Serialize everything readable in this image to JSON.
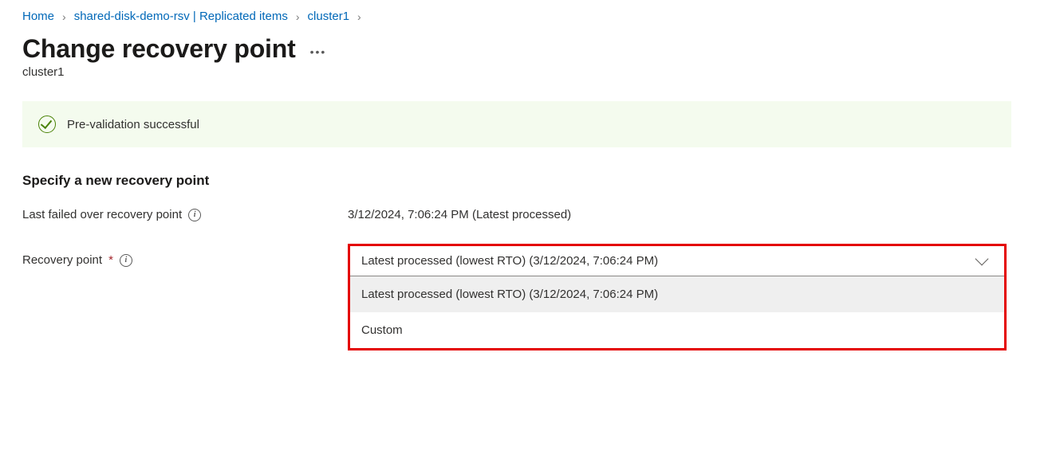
{
  "breadcrumb": {
    "home": "Home",
    "mid": "shared-disk-demo-rsv | Replicated items",
    "leaf": "cluster1"
  },
  "page_title": "Change recovery point",
  "subtitle": "cluster1",
  "notice_text": "Pre-validation successful",
  "section_heading": "Specify a new recovery point",
  "last_failed_label": "Last failed over recovery point",
  "last_failed_value": "3/12/2024, 7:06:24 PM (Latest processed)",
  "recovery_point_label": "Recovery point",
  "required_mark": "*",
  "dropdown": {
    "selected": "Latest processed (lowest RTO) (3/12/2024, 7:06:24 PM)",
    "options": [
      "Latest processed (lowest RTO) (3/12/2024, 7:06:24 PM)",
      "Custom"
    ]
  }
}
